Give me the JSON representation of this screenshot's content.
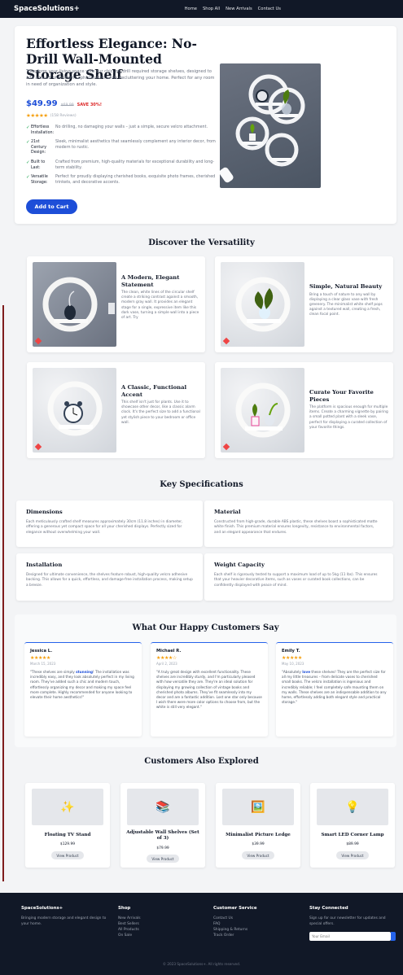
{
  "nav": {
    "brand": "SpaceSolutions+",
    "links": [
      "Home",
      "Shop All",
      "New Arrivals",
      "Contact Us"
    ]
  },
  "hero": {
    "title": "Effortless Elegance: No-Drill Wall-Mounted Storage Shelf",
    "lead": "Transform your living space with our chic, no-drill required storage shelves, designed to add a touch of modern sophistication while decluttering your home. Perfect for any room in need of organization and style.",
    "price": "$49.99",
    "old_price": "$69.99",
    "save": "SAVE 30%!",
    "stars": "★★★★★",
    "reviews": "(158 Reviews)",
    "features": [
      {
        "label": "Effortless Installation:",
        "text": "No drilling, no damaging your walls – just a simple, secure velcro attachment."
      },
      {
        "label": "21st Century Design:",
        "text": "Sleek, minimalist aesthetics that seamlessly complement any interior decor, from modern to rustic."
      },
      {
        "label": "Built to Last:",
        "text": "Crafted from premium, high-quality materials for exceptional durability and long-term stability."
      },
      {
        "label": "Versatile Storage:",
        "text": "Perfect for proudly displaying cherished books, exquisite photo frames, cherished trinkets, and decorative accents."
      }
    ],
    "cta": "Add to Cart"
  },
  "versatility": {
    "title": "Discover the Versatility",
    "cards": [
      {
        "title": "A Modern, Elegant Statement",
        "text": "The clean, white lines of the circular shelf create a striking contrast against a smooth, modern gray wall. It provides an elegant stage for a single, expressive item like this dark vase, turning a simple wall into a piece of art. Try"
      },
      {
        "title": "Simple, Natural Beauty",
        "text": "Bring a touch of nature to any wall by displaying a clear glass vase with fresh greenery. The minimalist white shelf pops against a textured wall, creating a fresh, clean focal point."
      },
      {
        "title": "A Classic, Functional Accent",
        "text": "This shelf isn't just for plants. Use it to showcase other decor, like a classic alarm clock. It's the perfect size to add a functional yet stylish piece to your bedroom or office wall."
      },
      {
        "title": "Curate Your Favorite Pieces",
        "text": "The platform is spacious enough for multiple items. Create a charming vignette by pairing a small potted plant with a sleek vase, perfect for displaying a curated collection of your favorite things."
      }
    ]
  },
  "specs": {
    "title": "Key Specifications",
    "items": [
      {
        "title": "Dimensions",
        "text": "Each meticulously crafted shelf measures approximately 30cm (11.8 inches) in diameter, offering a generous yet compact space for all your cherished displays. Perfectly sized for elegance without overwhelming your wall."
      },
      {
        "title": "Material",
        "text": "Constructed from high-grade, durable ABS plastic, these shelves boast a sophisticated matte white finish. This premium material ensures longevity, resistance to environmental factors, and an elegant appearance that endures."
      },
      {
        "title": "Installation",
        "text": "Designed for ultimate convenience, the shelves feature robust, high-quality velcro adhesive backing. This allows for a quick, effortless, and damage-free installation process, making setup a breeze."
      },
      {
        "title": "Weight Capacity",
        "text": "Each shelf is rigorously tested to support a maximum load of up to 5kg (11 lbs). This ensures that your heavier decorative items, such as vases or curated book collections, can be confidently displayed with peace of mind."
      }
    ]
  },
  "testimonials": {
    "title": "What Our Happy Customers Say",
    "items": [
      {
        "name": "Jessica L.",
        "stars": "★★★★★",
        "date": "March 15, 2023",
        "pre": "\"These shelves are simply ",
        "bold": "stunning",
        "post": "! The installation was incredibly easy, and they look absolutely perfect in my living room. They've added such a chic and modern touch, effortlessly organizing my decor and making my space feel more complete. Highly recommended for anyone looking to elevate their home aesthetics!\""
      },
      {
        "name": "Michael R.",
        "stars": "★★★★☆",
        "date": "April 2, 2023",
        "pre": "\"A truly great design with excellent functionality. These shelves are incredibly sturdy, and I'm particularly pleased with how versatile they are. They're an ideal solution for displaying my growing collection of vintage books and cherished photo albums. They've fit seamlessly into my decor and are a fantastic addition. Lost one star only because I wish there were more color options to choose from, but the white is still very elegant.\"",
        "bold": "",
        "post": ""
      },
      {
        "name": "Emily T.",
        "stars": "★★★★★",
        "date": "May 10, 2023",
        "pre": "\"Absolutely ",
        "bold": "love",
        "post": " these shelves! They are the perfect size for all my little treasures – from delicate vases to cherished small books. The velcro installation is ingenious and incredibly reliable; I feel completely safe mounting them on my walls. These shelves are an indispensable addition to any home, effortlessly adding both elegant style and practical storage.\""
      }
    ]
  },
  "explore": {
    "title": "Customers Also Explored",
    "button": "View Product",
    "items": [
      {
        "name": "Floating TV Stand",
        "price": "$129.99",
        "icon": "✨"
      },
      {
        "name": "Adjustable Wall Shelves (Set of 3)",
        "price": "$79.99",
        "icon": "📚"
      },
      {
        "name": "Minimalist Picture Ledge",
        "price": "$39.99",
        "icon": "🖼️"
      },
      {
        "name": "Smart LED Corner Lamp",
        "price": "$89.99",
        "icon": "💡"
      }
    ]
  },
  "footer": {
    "brand": "SpaceSolutions+",
    "tagline": "Bringing modern storage and elegant design to your home.",
    "shop_title": "Shop",
    "shop_links": [
      "New Arrivals",
      "Best Sellers",
      "All Products",
      "On Sale"
    ],
    "service_title": "Customer Service",
    "service_links": [
      "Contact Us",
      "FAQ",
      "Shipping & Returns",
      "Track Order"
    ],
    "connect_title": "Stay Connected",
    "connect_text": "Sign up for our newsletter for updates and special offers.",
    "email_placeholder": "Your Email",
    "copyright": "© 2023 SpaceSolutions+. All rights reserved."
  }
}
